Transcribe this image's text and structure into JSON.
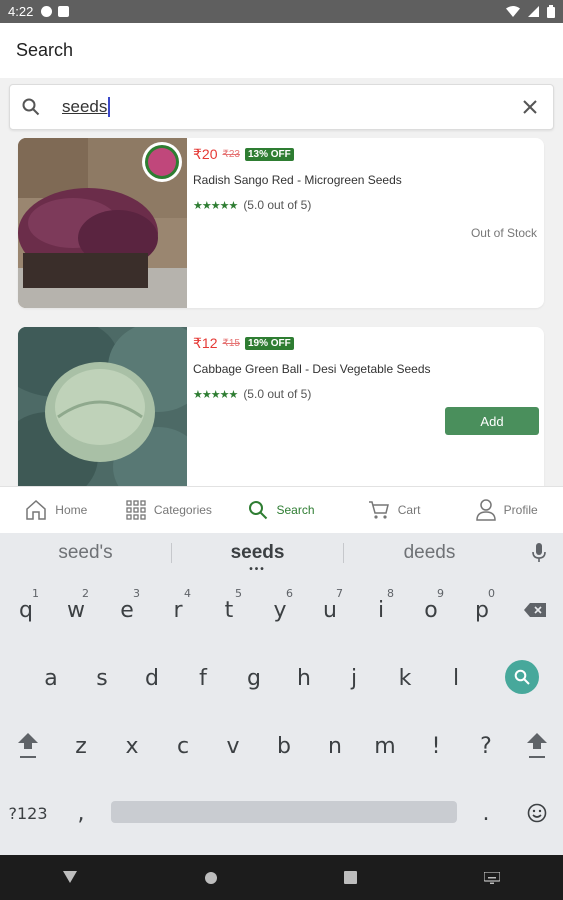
{
  "status_bar": {
    "time": "4:22"
  },
  "app_bar": {
    "title": "Search"
  },
  "search": {
    "query": "seeds"
  },
  "products": [
    {
      "price": "₹20",
      "mrp": "₹23",
      "discount": "13% OFF",
      "name": "Radish Sango Red - Microgreen Seeds",
      "stars": "★★★★★",
      "rating": "(5.0 out of 5)",
      "availability": "Out of Stock"
    },
    {
      "price": "₹12",
      "mrp": "₹15",
      "discount": "19% OFF",
      "name": "Cabbage Green Ball - Desi Vegetable Seeds",
      "stars": "★★★★★",
      "rating": "(5.0 out of 5)",
      "action": "Add"
    }
  ],
  "bottom_nav": [
    {
      "label": "Home",
      "icon": "home-icon"
    },
    {
      "label": "Categories",
      "icon": "grid-icon"
    },
    {
      "label": "Search",
      "icon": "search-icon",
      "active": true
    },
    {
      "label": "Cart",
      "icon": "cart-icon"
    },
    {
      "label": "Profile",
      "icon": "person-icon"
    }
  ],
  "keyboard": {
    "suggestions": [
      "seed's",
      "seeds",
      "deeds"
    ],
    "row1": [
      "q",
      "w",
      "e",
      "r",
      "t",
      "y",
      "u",
      "i",
      "o",
      "p"
    ],
    "row1_hints": [
      "1",
      "2",
      "3",
      "4",
      "5",
      "6",
      "7",
      "8",
      "9",
      "0"
    ],
    "row2": [
      "a",
      "s",
      "d",
      "f",
      "g",
      "h",
      "j",
      "k",
      "l"
    ],
    "row3": [
      "z",
      "x",
      "c",
      "v",
      "b",
      "n",
      "m",
      "!",
      "?"
    ],
    "symbols_key": "?123",
    "comma": ",",
    "period": "."
  },
  "colors": {
    "accent_green": "#2e7d32",
    "price_red": "#e53935",
    "add_button": "#4a8f5c",
    "enter_key": "#47a89b"
  }
}
